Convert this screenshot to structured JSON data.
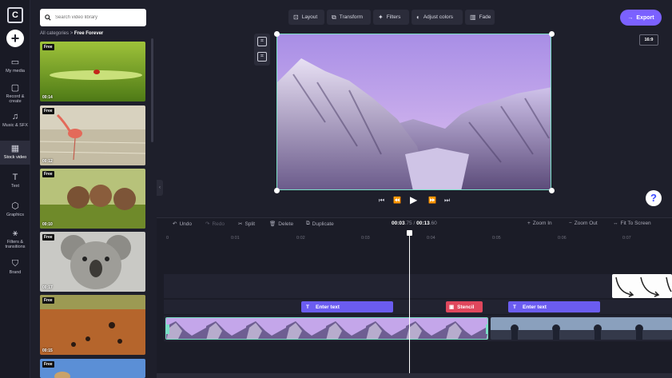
{
  "sidebar": {
    "logo_letter": "C",
    "items": [
      {
        "label": "My media",
        "icon": "folder-icon"
      },
      {
        "label": "Record & create",
        "icon": "camera-icon"
      },
      {
        "label": "Music & SFX",
        "icon": "music-icon"
      },
      {
        "label": "Stock video",
        "icon": "film-icon",
        "active": true
      },
      {
        "label": "Text",
        "icon": "text-icon"
      },
      {
        "label": "Graphics",
        "icon": "shapes-icon"
      },
      {
        "label": "Filters & transitions",
        "icon": "wand-icon"
      },
      {
        "label": "Brand",
        "icon": "shield-icon"
      }
    ]
  },
  "library": {
    "search_placeholder": "Search video library",
    "breadcrumb_root": "All categories",
    "breadcrumb_sep": ">",
    "breadcrumb_current": "Free Forever",
    "videos": [
      {
        "badge": "Free",
        "duration": "00:14"
      },
      {
        "badge": "Free",
        "duration": "00:12"
      },
      {
        "badge": "Free",
        "duration": "00:10"
      },
      {
        "badge": "Free",
        "duration": "00:17"
      },
      {
        "badge": "Free",
        "duration": "00:15"
      },
      {
        "badge": "Free",
        "duration": ""
      }
    ]
  },
  "toolbar": {
    "layout": "Layout",
    "transform": "Transform",
    "filters": "Filters",
    "adjust_colors": "Adjust colors",
    "fade": "Fade",
    "export": "Export"
  },
  "preview": {
    "aspect_ratio": "16:9"
  },
  "help_label": "?",
  "timeline": {
    "undo": "Undo",
    "redo": "Redo",
    "split": "Split",
    "delete": "Delete",
    "duplicate": "Duplicate",
    "current_time": "00:03",
    "current_frac": ".75",
    "time_sep": " / ",
    "total_time": "00:13",
    "total_frac": ".60",
    "zoom_in": "Zoom In",
    "zoom_out": "Zoom Out",
    "fit_to_screen": "Fit To Screen",
    "ticks": [
      "0",
      "0:01",
      "0:02",
      "0:03",
      "0:04",
      "0:05",
      "0:06",
      "0:07"
    ],
    "text_clip_1": "Enter text",
    "stencil_clip": "Stencil",
    "text_clip_2": "Enter text"
  },
  "colors": {
    "accent": "#7b61ff",
    "text_clip": "#6b5cf0",
    "stencil": "#e0475d",
    "selection": "#7adfc6"
  }
}
